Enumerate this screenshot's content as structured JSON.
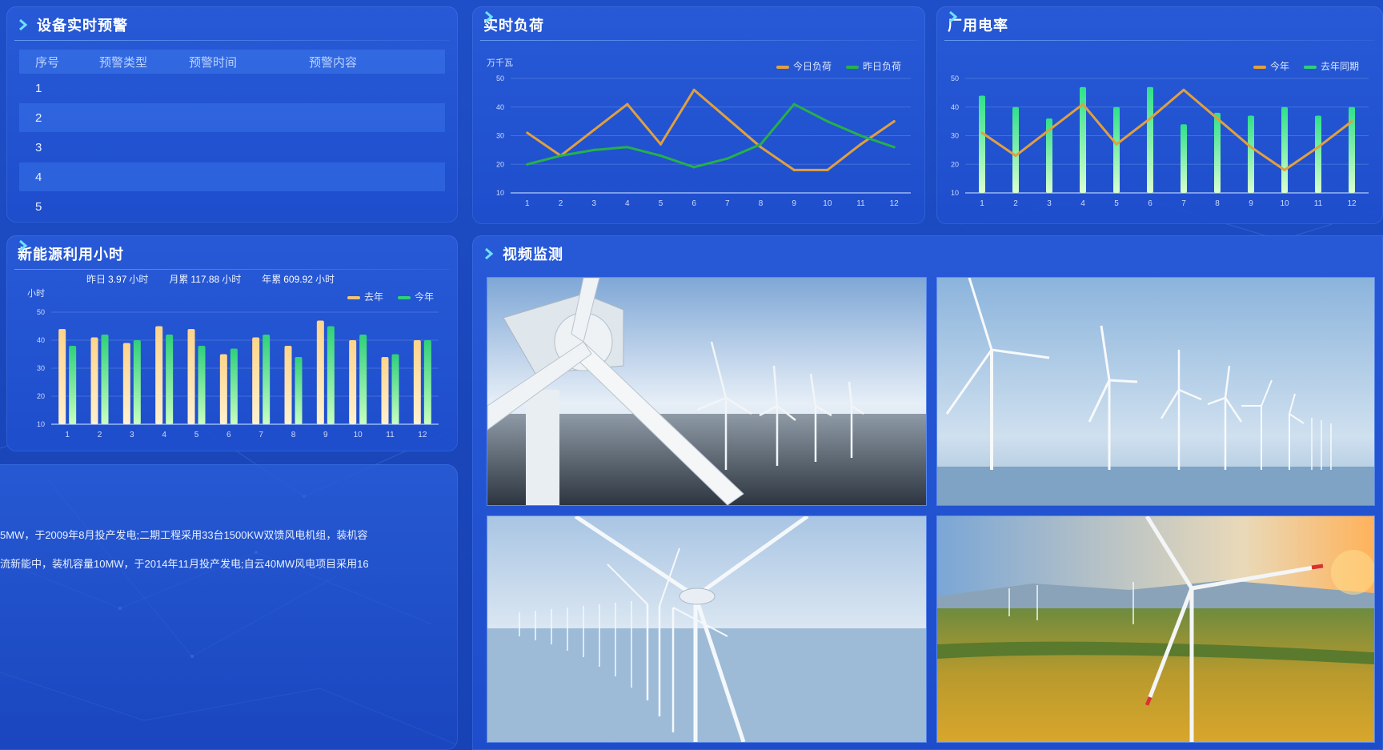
{
  "panels": {
    "alarm": {
      "title": "设备实时预警",
      "headers": [
        "序号",
        "预警类型",
        "预警时间",
        "预警内容"
      ],
      "rows": [
        {
          "no": "1",
          "type": "",
          "time": "",
          "content": ""
        },
        {
          "no": "2",
          "type": "",
          "time": "",
          "content": ""
        },
        {
          "no": "3",
          "type": "",
          "time": "",
          "content": ""
        },
        {
          "no": "4",
          "type": "",
          "time": "",
          "content": ""
        },
        {
          "no": "5",
          "type": "",
          "time": "",
          "content": ""
        }
      ]
    },
    "load": {
      "title": "实时负荷",
      "unit": "万千瓦",
      "legend": [
        "今日负荷",
        "昨日负荷"
      ]
    },
    "rate": {
      "title": "厂用电率",
      "legend": [
        "今年",
        "去年同期"
      ]
    },
    "hours": {
      "title": "新能源利用小时",
      "unit": "小时",
      "legend": [
        "去年",
        "今年"
      ],
      "stats": [
        {
          "label": "昨日",
          "value": "3.97",
          "unit": "小时"
        },
        {
          "label": "月累",
          "value": "117.88",
          "unit": "小时"
        },
        {
          "label": "年累",
          "value": "609.92",
          "unit": "小时"
        }
      ]
    },
    "video": {
      "title": "视频监测"
    },
    "description": {
      "line1": "5MW，于2009年8月投产发电;二期工程采用33台1500KW双馈风电机组，装机容",
      "line2": "流新能中，装机容量10MW，于2014年11月投产发电;自云40MW风电项目采用16"
    }
  },
  "colors": {
    "orange": "#f2c27a",
    "green": "#2fd07a",
    "line_orange": "#e0a040",
    "line_green": "#27b04a"
  },
  "chart_data": [
    {
      "type": "line",
      "title": "实时负荷",
      "ylabel": "万千瓦",
      "x": [
        "1",
        "2",
        "3",
        "4",
        "5",
        "6",
        "7",
        "8",
        "9",
        "10",
        "11",
        "12"
      ],
      "ylim": [
        10,
        50
      ],
      "yticks": [
        "10",
        "20",
        "30",
        "40",
        "50"
      ],
      "series": [
        {
          "name": "今日负荷",
          "values": [
            31,
            23,
            32,
            41,
            27,
            46,
            36,
            26,
            18,
            18,
            27,
            35
          ]
        },
        {
          "name": "昨日负荷",
          "values": [
            20,
            23,
            25,
            26,
            23,
            19,
            22,
            27,
            41,
            35,
            30,
            26
          ]
        }
      ]
    },
    {
      "type": "bar+line",
      "title": "厂用电率",
      "x": [
        "1",
        "2",
        "3",
        "4",
        "5",
        "6",
        "7",
        "8",
        "9",
        "10",
        "11",
        "12"
      ],
      "ylim": [
        10,
        50
      ],
      "yticks": [
        "10",
        "20",
        "30",
        "40",
        "50"
      ],
      "series": [
        {
          "name": "去年同期",
          "kind": "bar",
          "values": [
            44,
            40,
            36,
            47,
            40,
            47,
            34,
            38,
            37,
            40,
            37,
            40
          ]
        },
        {
          "name": "今年",
          "kind": "line",
          "values": [
            31,
            23,
            32,
            41,
            27,
            36,
            46,
            36,
            26,
            18,
            26,
            35
          ]
        }
      ]
    },
    {
      "type": "bar",
      "title": "新能源利用小时",
      "ylabel": "小时",
      "x": [
        "1",
        "2",
        "3",
        "4",
        "5",
        "6",
        "7",
        "8",
        "9",
        "10",
        "11",
        "12"
      ],
      "ylim": [
        10,
        50
      ],
      "yticks": [
        "10",
        "20",
        "30",
        "40",
        "50"
      ],
      "series": [
        {
          "name": "去年",
          "values": [
            44,
            41,
            39,
            45,
            44,
            35,
            41,
            38,
            47,
            40,
            34,
            40
          ]
        },
        {
          "name": "今年",
          "values": [
            38,
            42,
            40,
            42,
            38,
            37,
            42,
            34,
            45,
            42,
            35,
            40
          ]
        }
      ]
    }
  ]
}
